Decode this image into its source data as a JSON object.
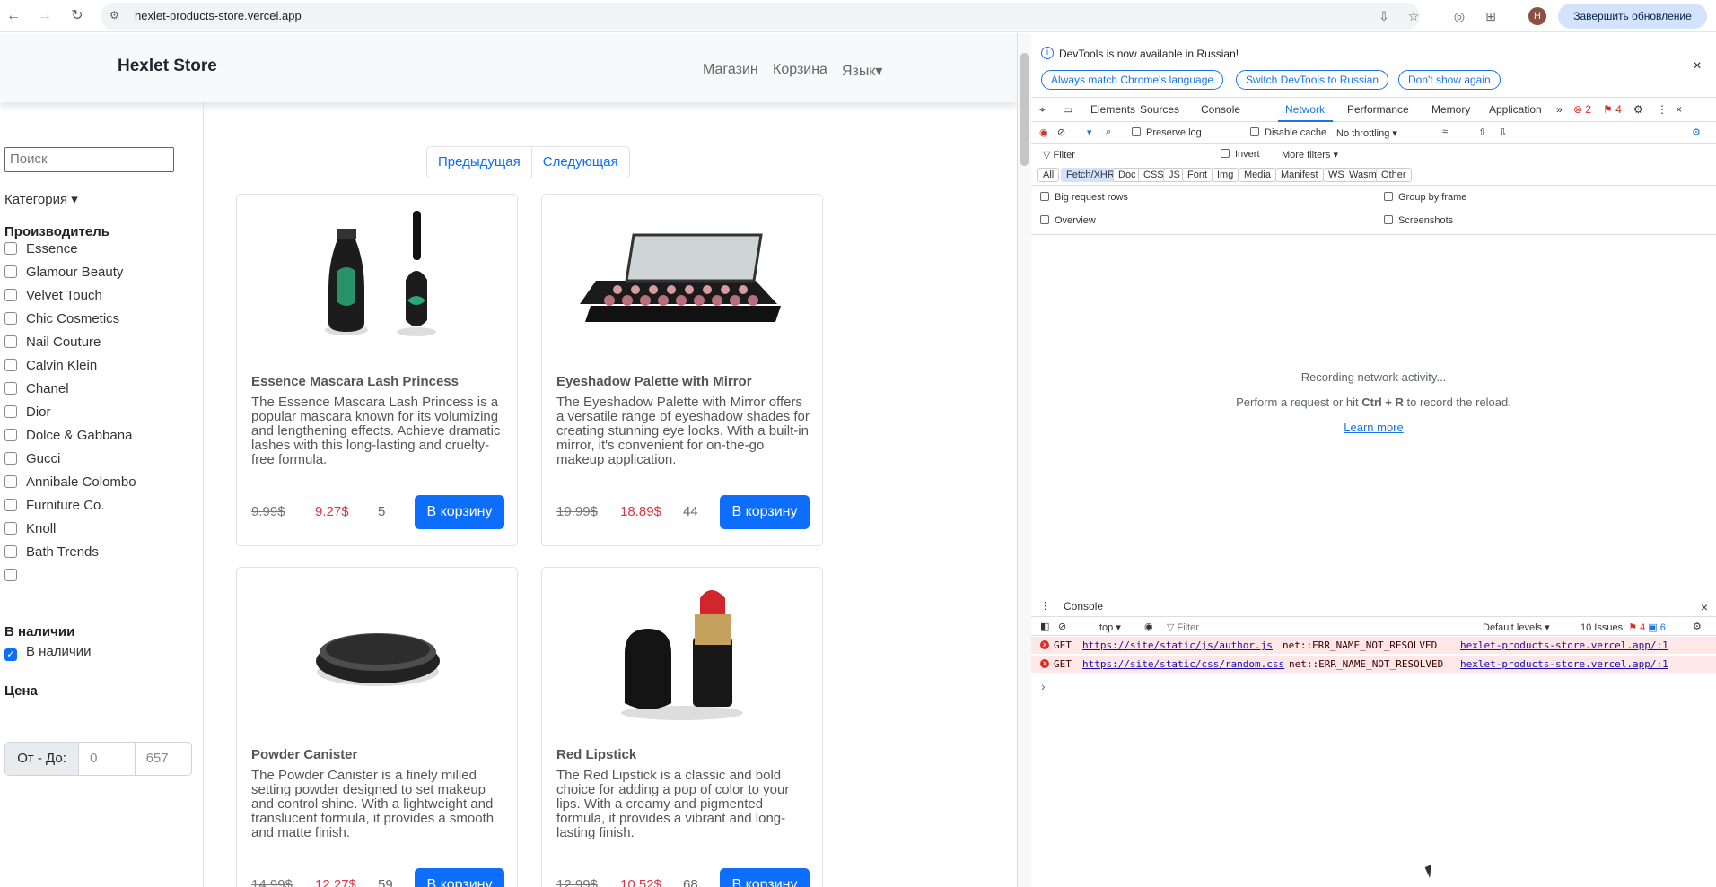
{
  "browser": {
    "url": "hexlet-products-store.vercel.app",
    "update_button": "Завершить обновление",
    "avatar_letter": "H"
  },
  "store": {
    "brand": "Hexlet Store",
    "nav": [
      "Магазин",
      "Корзина",
      "Язык▾"
    ],
    "search_placeholder": "Поиск",
    "category": "Категория ▾",
    "manufacturer_title": "Производитель",
    "manufacturers": [
      "Essence",
      "Glamour Beauty",
      "Velvet Touch",
      "Chic Cosmetics",
      "Nail Couture",
      "Calvin Klein",
      "Chanel",
      "Dior",
      "Dolce & Gabbana",
      "Gucci",
      "Annibale Colombo",
      "Furniture Co.",
      "Knoll",
      "Bath Trends",
      ""
    ],
    "availability_title": "В наличии",
    "availability_label": "В наличии",
    "price_title": "Цена",
    "price_label": "От - До:",
    "price_from": "0",
    "price_to": "657",
    "pager": [
      "Предыдущая",
      "Следующая"
    ],
    "cart_button": "В корзину",
    "products": [
      {
        "title": "Essence Mascara Lash Princess",
        "description": "The Essence Mascara Lash Princess is a popular mascara known for its volumizing and lengthening effects. Achieve dramatic lashes with this long-lasting and cruelty-free formula.",
        "old_price": "9.99$",
        "new_price": "9.27$",
        "stock": "5"
      },
      {
        "title": "Eyeshadow Palette with Mirror",
        "description": "The Eyeshadow Palette with Mirror offers a versatile range of eyeshadow shades for creating stunning eye looks. With a built-in mirror, it's convenient for on-the-go makeup application.",
        "old_price": "19.99$",
        "new_price": "18.89$",
        "stock": "44"
      },
      {
        "title": "Powder Canister",
        "description": "The Powder Canister is a finely milled setting powder designed to set makeup and control shine. With a lightweight and translucent formula, it provides a smooth and matte finish.",
        "old_price": "14.99$",
        "new_price": "12.27$",
        "stock": "59"
      },
      {
        "title": "Red Lipstick",
        "description": "The Red Lipstick is a classic and bold choice for adding a pop of color to your lips. With a creamy and pigmented formula, it provides a vibrant and long-lasting finish.",
        "old_price": "12.99$",
        "new_price": "10.52$",
        "stock": "68"
      }
    ]
  },
  "devtools": {
    "banner": "DevTools is now available in Russian!",
    "banner_buttons": [
      "Always match Chrome's language",
      "Switch DevTools to Russian",
      "Don't show again"
    ],
    "tabs": [
      "Elements",
      "Sources",
      "Console",
      "Network",
      "Performance",
      "Memory",
      "Application"
    ],
    "error_count": "2",
    "issue_count": "4",
    "toolbar": {
      "preserve_log": "Preserve log",
      "disable_cache": "Disable cache",
      "throttling": "No throttling"
    },
    "filter_placeholder": "Filter",
    "invert": "Invert",
    "more_filters": "More filters ▾",
    "chips": [
      "All",
      "Fetch/XHR",
      "Doc",
      "CSS",
      "JS",
      "Font",
      "Img",
      "Media",
      "Manifest",
      "WS",
      "Wasm",
      "Other"
    ],
    "options": [
      "Big request rows",
      "Group by frame",
      "Overview",
      "Screenshots"
    ],
    "empty": {
      "line1": "Recording network activity...",
      "line2_a": "Perform a request or hit",
      "line2_b": "Ctrl + R",
      "line2_c": "to record the reload.",
      "link": "Learn more"
    },
    "console": {
      "title": "Console",
      "context": "top ▾",
      "filter": "Filter",
      "levels": "Default levels ▾",
      "issues": "10 Issues:",
      "issue_red": "4",
      "issue_blue": "6",
      "errors": [
        {
          "method": "GET",
          "url": "https://site/static/js/author.js",
          "message": "net::ERR_NAME_NOT_RESOLVED",
          "source": "hexlet-products-store.vercel.app/:1"
        },
        {
          "method": "GET",
          "url": "https://site/static/css/random.css",
          "message": "net::ERR_NAME_NOT_RESOLVED",
          "source": "hexlet-products-store.vercel.app/:1"
        }
      ],
      "prompt": "›"
    }
  }
}
